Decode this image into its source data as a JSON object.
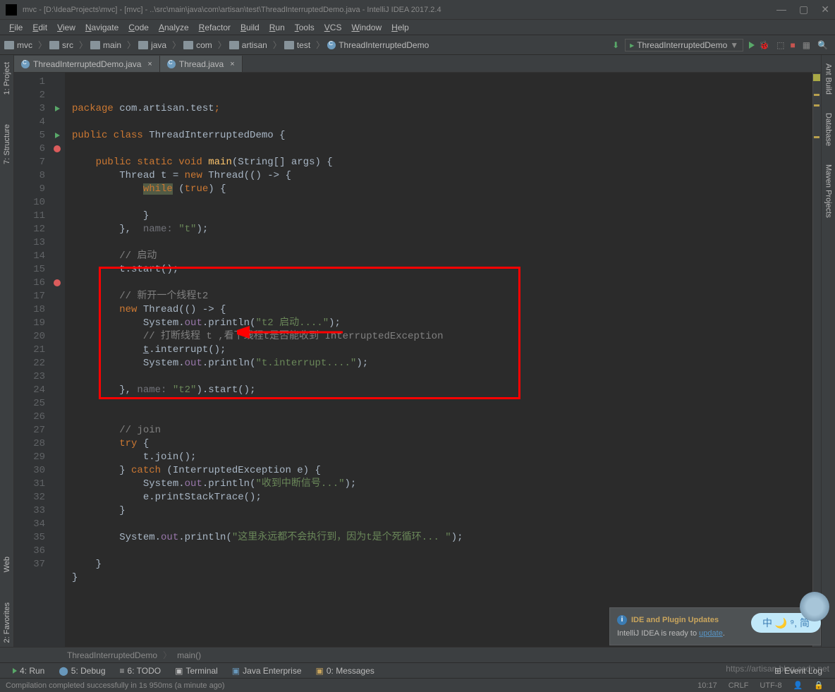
{
  "title": "mvc - [D:\\IdeaProjects\\mvc] - [mvc] - ..\\src\\main\\java\\com\\artisan\\test\\ThreadInterruptedDemo.java - IntelliJ IDEA 2017.2.4",
  "menu": [
    "File",
    "Edit",
    "View",
    "Navigate",
    "Code",
    "Analyze",
    "Refactor",
    "Build",
    "Run",
    "Tools",
    "VCS",
    "Window",
    "Help"
  ],
  "breadcrumbs": [
    "mvc",
    "src",
    "main",
    "java",
    "com",
    "artisan",
    "test"
  ],
  "breadcrumb_file": "ThreadInterruptedDemo",
  "run_config": "ThreadInterruptedDemo",
  "left_tabs": [
    "1: Project",
    "7: Structure"
  ],
  "left_bottom_tabs": [
    "Web",
    "2: Favorites"
  ],
  "right_tabs": [
    "Ant Build",
    "Database",
    "Maven Projects"
  ],
  "editor_tabs": [
    {
      "label": "ThreadInterruptedDemo.java",
      "active": true
    },
    {
      "label": "Thread.java",
      "active": false
    }
  ],
  "code_lines": [
    {
      "n": 1,
      "html": "<span class='kw'>package</span> com.artisan.test<span class='kw'>;</span>"
    },
    {
      "n": 2,
      "html": ""
    },
    {
      "n": 3,
      "html": "<span class='kw'>public class</span> ThreadInterruptedDemo {",
      "play": true
    },
    {
      "n": 4,
      "html": ""
    },
    {
      "n": 5,
      "html": "    <span class='kw'>public static void</span> <span class='mth'>main</span>(String[] args) {",
      "play": true
    },
    {
      "n": 6,
      "html": "        Thread t = <span class='kw'>new</span> Thread(() -> {",
      "break": true
    },
    {
      "n": 7,
      "html": "            <span class='hl kw'>while</span> (<span class='kw'>true</span>) {"
    },
    {
      "n": 8,
      "html": ""
    },
    {
      "n": 9,
      "html": "            }"
    },
    {
      "n": 10,
      "html": "        },  <span class='param'>name:</span> <span class='str'>\"t\"</span>);"
    },
    {
      "n": 11,
      "html": ""
    },
    {
      "n": 12,
      "html": "        <span class='com'>// 启动</span>"
    },
    {
      "n": 13,
      "html": "        t.start();"
    },
    {
      "n": 14,
      "html": ""
    },
    {
      "n": 15,
      "html": "        <span class='com'>// 新开一个线程t2</span>"
    },
    {
      "n": 16,
      "html": "        <span class='kw'>new</span> Thread(() -> {",
      "break": true
    },
    {
      "n": 17,
      "html": "            System.<span class='fld'>out</span>.println(<span class='str'>\"t2 启动....\"</span>);"
    },
    {
      "n": 18,
      "html": "            <span class='com'>// 打断线程 t ,看下线程t是否能收到 InterruptedException</span>"
    },
    {
      "n": 19,
      "html": "            <u>t</u>.interrupt();"
    },
    {
      "n": 20,
      "html": "            System.<span class='fld'>out</span>.println(<span class='str'>\"t.interrupt....\"</span>);"
    },
    {
      "n": 21,
      "html": ""
    },
    {
      "n": 22,
      "html": "        }, <span class='param'>name:</span> <span class='str'>\"t2\"</span>).start();"
    },
    {
      "n": 23,
      "html": ""
    },
    {
      "n": 24,
      "html": ""
    },
    {
      "n": 25,
      "html": "        <span class='com'>// join</span>"
    },
    {
      "n": 26,
      "html": "        <span class='kw'>try</span> {"
    },
    {
      "n": 27,
      "html": "            t.join();"
    },
    {
      "n": 28,
      "html": "        } <span class='kw'>catch</span> (InterruptedException e) {"
    },
    {
      "n": 29,
      "html": "            System.<span class='fld'>out</span>.println(<span class='str'>\"收到中断信号...\"</span>);"
    },
    {
      "n": 30,
      "html": "            e.printStackTrace();"
    },
    {
      "n": 31,
      "html": "        }"
    },
    {
      "n": 32,
      "html": ""
    },
    {
      "n": 33,
      "html": "        System.<span class='fld'>out</span>.println(<span class='str'>\"这里永远都不会执行到，因为t是个死循环... \"</span>);"
    },
    {
      "n": 34,
      "html": ""
    },
    {
      "n": 35,
      "html": "    }"
    },
    {
      "n": 36,
      "html": "}"
    },
    {
      "n": 37,
      "html": ""
    }
  ],
  "bottom_breadcrumb": [
    "ThreadInterruptedDemo",
    "main()"
  ],
  "bottom_tabs": [
    "4: Run",
    "5: Debug",
    "6: TODO",
    "Terminal",
    "Java Enterprise",
    "0: Messages"
  ],
  "event_log": "Event Log",
  "status_msg": "Compilation completed successfully in 1s 950ms (a minute ago)",
  "status_pos": "10:17",
  "status_lineend": "CRLF",
  "status_enc": "UTF-8",
  "notif_title": "IDE and Plugin Updates",
  "notif_body": "IntelliJ IDEA is ready to ",
  "notif_link": "update",
  "ime_text": "中 🌙 ⁹, 简",
  "watermark": "https://artisan.blog.csdn.net"
}
